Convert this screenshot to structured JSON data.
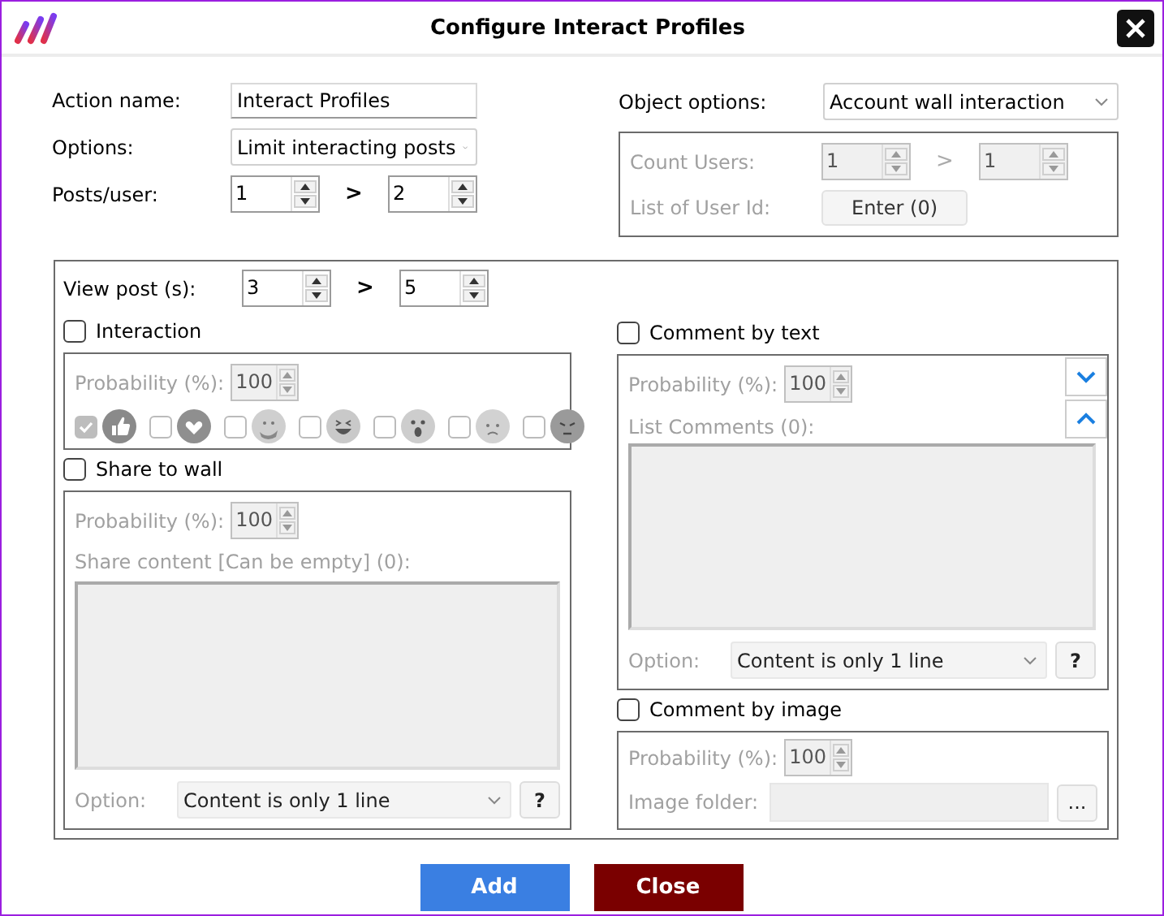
{
  "window": {
    "title": "Configure Interact Profiles"
  },
  "action_name": {
    "label": "Action name:",
    "value": "Interact Profiles"
  },
  "options": {
    "label": "Options:",
    "value": "Limit interacting posts"
  },
  "posts_per_user": {
    "label": "Posts/user:",
    "from": "1",
    "separator": ">",
    "to": "2"
  },
  "object_options": {
    "label": "Object options:",
    "value": "Account wall interaction",
    "disabled": true,
    "count_users": {
      "label": "Count Users:",
      "from": "1",
      "separator": ">",
      "to": "1"
    },
    "user_ids": {
      "label": "List of User Id:",
      "button": "Enter (0)"
    }
  },
  "view_posts": {
    "label": "View post (s):",
    "from": "3",
    "separator": ">",
    "to": "5"
  },
  "sections": [
    {
      "kind": "interaction",
      "label": "Interaction",
      "checked": false,
      "probability": {
        "label": "Probability (%):",
        "value": "100"
      },
      "reactions": [
        {
          "kind": "like",
          "checked": true
        },
        {
          "kind": "love",
          "checked": false
        },
        {
          "kind": "care",
          "checked": false
        },
        {
          "kind": "haha",
          "checked": false
        },
        {
          "kind": "wow",
          "checked": false
        },
        {
          "kind": "sad",
          "checked": false
        },
        {
          "kind": "angry",
          "checked": false
        }
      ]
    },
    {
      "kind": "share",
      "label": "Share to wall",
      "checked": false,
      "probability": {
        "label": "Probability (%):",
        "value": "100"
      },
      "content_label": "Share content [Can be empty] (0):",
      "option": {
        "label": "Option:",
        "value": "Content is only 1 line",
        "help": "?"
      }
    },
    {
      "kind": "comment_text",
      "label": "Comment by text",
      "checked": false,
      "probability": {
        "label": "Probability (%):",
        "value": "100"
      },
      "list_label": "List Comments (0):",
      "option": {
        "label": "Option:",
        "value": "Content is only 1 line",
        "help": "?"
      }
    },
    {
      "kind": "comment_image",
      "label": "Comment by image",
      "checked": false,
      "probability": {
        "label": "Probability (%):",
        "value": "100"
      },
      "folder": {
        "label": "Image folder:",
        "browse": "..."
      }
    }
  ],
  "buttons": [
    {
      "kind": "primary",
      "label": "Add"
    },
    {
      "kind": "danger",
      "label": "Close"
    }
  ]
}
